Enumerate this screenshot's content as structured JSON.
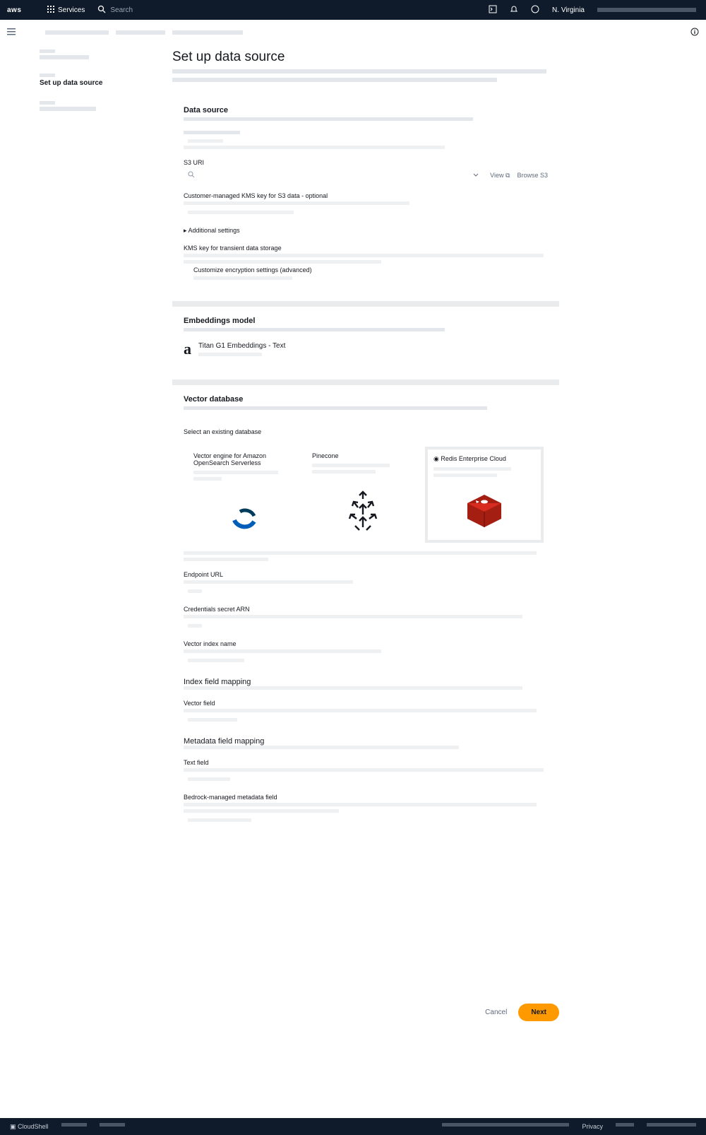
{
  "topbar": {
    "logo": "aws",
    "services_label": "Services",
    "search_placeholder": "Search",
    "region": "N. Virginia"
  },
  "main": {
    "title": "Set up data source",
    "data_source": {
      "title": "Data source",
      "s3_uri_label": "S3 URI",
      "view_label": "View",
      "browse_label": "Browse S3",
      "kms_label": "Customer-managed KMS key for S3 data - optional",
      "additional_settings": "Additional settings",
      "kms_key_label": "KMS key for transient data storage",
      "kms_custom_option": "Customize encryption settings (advanced)"
    },
    "embeddings": {
      "title": "Embeddings model",
      "model_name": "Titan G1 Embeddings - Text"
    },
    "vector_db": {
      "title": "Vector database",
      "select_label": "Select an existing database",
      "tiles": [
        {
          "name": "Vector engine for Amazon OpenSearch Serverless"
        },
        {
          "name": "Pinecone"
        },
        {
          "name": "Redis Enterprise Cloud"
        }
      ],
      "endpoint_label": "Endpoint URL",
      "credentials_label": "Credentials secret ARN",
      "vector_index_label": "Vector index name",
      "index_field_mapping": "Index field mapping",
      "vector_field_label": "Vector field",
      "metadata_field_mapping": "Metadata field mapping",
      "text_field_label": "Text field",
      "metadata_field_label": "Bedrock-managed metadata field"
    }
  },
  "actions": {
    "cancel": "Cancel",
    "next": "Next"
  },
  "footer": {
    "cloudshell": "CloudShell",
    "privacy": "Privacy"
  }
}
